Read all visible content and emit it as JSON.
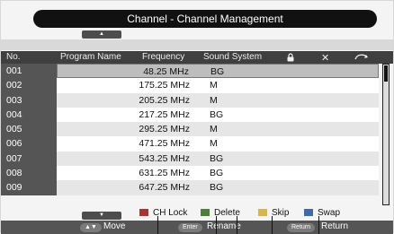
{
  "title": "Channel - Channel Management",
  "columns": {
    "no": "No.",
    "program_name": "Program Name",
    "frequency": "Frequency",
    "sound_system": "Sound System"
  },
  "rows": [
    {
      "no": "001",
      "program": "",
      "freq": "48.25 MHz",
      "sound": "BG"
    },
    {
      "no": "002",
      "program": "",
      "freq": "175.25 MHz",
      "sound": "M"
    },
    {
      "no": "003",
      "program": "",
      "freq": "205.25 MHz",
      "sound": "M"
    },
    {
      "no": "004",
      "program": "",
      "freq": "217.25 MHz",
      "sound": "BG"
    },
    {
      "no": "005",
      "program": "",
      "freq": "295.25 MHz",
      "sound": "M"
    },
    {
      "no": "006",
      "program": "",
      "freq": "471.25 MHz",
      "sound": "M"
    },
    {
      "no": "007",
      "program": "",
      "freq": "543.25 MHz",
      "sound": "BG"
    },
    {
      "no": "008",
      "program": "",
      "freq": "631.25 MHz",
      "sound": "BG"
    },
    {
      "no": "009",
      "program": "",
      "freq": "647.25 MHz",
      "sound": "BG"
    }
  ],
  "legend": [
    {
      "label": "CH Lock",
      "color": "#a3362e"
    },
    {
      "label": "Delete",
      "color": "#4d7f3a"
    },
    {
      "label": "Skip",
      "color": "#d6b64a"
    },
    {
      "label": "Swap",
      "color": "#3f69a8"
    }
  ],
  "controls": {
    "move_label": "Move",
    "enter_key": "Enter",
    "rename_label": "Rename",
    "return_key": "Return",
    "return_label": "Return"
  }
}
